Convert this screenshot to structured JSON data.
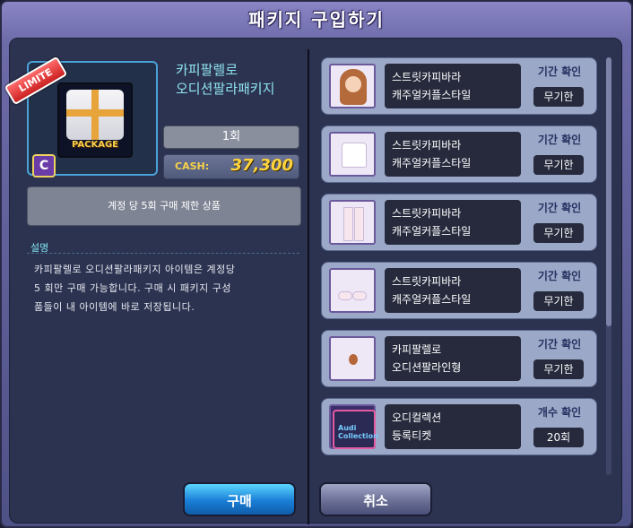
{
  "dialog": {
    "title": "패키지 구입하기"
  },
  "package": {
    "badge": "LIMITE",
    "thumb_label": "PACKAGE",
    "rank_badge": "C",
    "name_line1": "카피팔렐로",
    "name_line2": "오디션팔라패키지",
    "count": "1회",
    "cash_label": "CASH:",
    "cash_value": "37,300",
    "limit_text": "계정 당 5회 구매 제한 상품",
    "desc_label": "설명",
    "desc_line1": "카피팔렐로 오디션팔라패키지 아이템은 계정당",
    "desc_line2": "5 회만 구매 가능합니다. 구매 시 패키지 구성",
    "desc_line3": "품들이 내 아이템에 바로 저장됩니다."
  },
  "items": [
    {
      "name1": "스트릿카피바라",
      "name2": "캐주얼커플스타일",
      "label": "기간 확인",
      "value": "무기한",
      "icon": "hair-icon"
    },
    {
      "name1": "스트릿카피바라",
      "name2": "캐주얼커플스타일",
      "label": "기간 확인",
      "value": "무기한",
      "icon": "shirt-icon"
    },
    {
      "name1": "스트릿카피바라",
      "name2": "캐주얼커플스타일",
      "label": "기간 확인",
      "value": "무기한",
      "icon": "pants-icon"
    },
    {
      "name1": "스트릿카피바라",
      "name2": "캐주얼커플스타일",
      "label": "기간 확인",
      "value": "무기한",
      "icon": "shoes-icon"
    },
    {
      "name1": "카피팔렐로",
      "name2": "오디션팔라인형",
      "label": "기간 확인",
      "value": "무기한",
      "icon": "doll-icon"
    },
    {
      "name1": "오디컬렉션",
      "name2": "등록티켓",
      "label": "개수 확인",
      "value": "20회",
      "icon": "ticket-icon",
      "thumb_text": "Audi Collection"
    }
  ],
  "buttons": {
    "buy": "구매",
    "cancel": "취소"
  }
}
